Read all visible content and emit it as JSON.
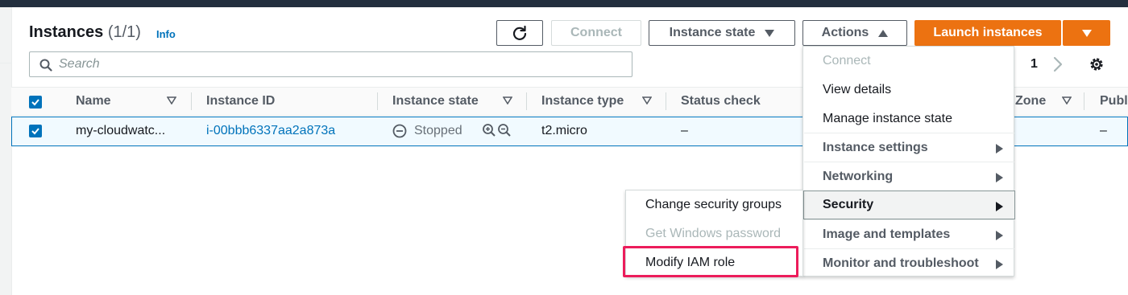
{
  "header": {
    "title": "Instances",
    "count": "(1/1)",
    "info_link": "Info"
  },
  "toolbar": {
    "refresh_icon": "refresh-icon",
    "connect_label": "Connect",
    "instance_state_label": "Instance state",
    "actions_label": "Actions",
    "launch_label": "Launch instances"
  },
  "search": {
    "placeholder": "Search",
    "value": ""
  },
  "pagination": {
    "current_page": "1"
  },
  "table": {
    "columns": [
      "Name",
      "Instance ID",
      "Instance state",
      "Instance type",
      "Status check",
      "Zone",
      "Publ"
    ],
    "rows": [
      {
        "name": "my-cloudwatc...",
        "instance_id": "i-00bbb6337aa2a873a",
        "state": "Stopped",
        "type": "t2.micro",
        "status_check": "–",
        "public": "–"
      }
    ]
  },
  "actions_menu": {
    "items": [
      {
        "label": "Connect",
        "disabled": true
      },
      {
        "label": "View details"
      },
      {
        "label": "Manage instance state"
      },
      {
        "label": "Instance settings",
        "submenu": true
      },
      {
        "label": "Networking",
        "submenu": true
      },
      {
        "label": "Security",
        "submenu": true,
        "active": true
      },
      {
        "label": "Image and templates",
        "submenu": true
      },
      {
        "label": "Monitor and troubleshoot",
        "submenu": true
      }
    ]
  },
  "security_submenu": {
    "items": [
      {
        "label": "Change security groups"
      },
      {
        "label": "Get Windows password",
        "disabled": true
      },
      {
        "label": "Modify IAM role",
        "highlighted": true
      }
    ]
  },
  "colors": {
    "primary_orange": "#ec7211",
    "link_blue": "#0073bb",
    "highlight_pink": "#ec1c5b",
    "top_bar": "#232f3e"
  }
}
